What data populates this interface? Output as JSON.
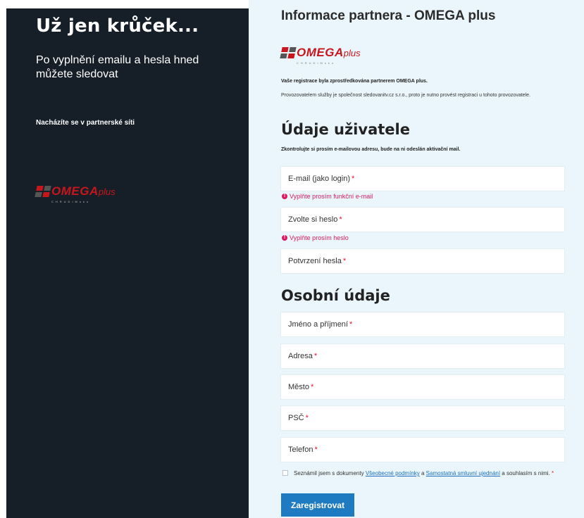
{
  "left": {
    "title": "Už jen krůček...",
    "subtitle": "Po vyplnění emailu a hesla hned můžete sledovat",
    "partner_note": "Nacházíte se v partnerské síti",
    "logo_text": "OMEGA",
    "logo_plus": "plus",
    "logo_small": "CHRUDIMsko"
  },
  "right": {
    "title": "Informace partnera - OMEGA plus",
    "logo_text": "OMEGA",
    "logo_plus": "plus",
    "logo_small": "CHRUDIMsko",
    "registration_note": "Vaše registrace byla zprostředkována partnerem OMEGA plus.",
    "provider_note": "Provozovatelem služby je společnost sledovanitv.cz s.r.o., proto je nutno provést registraci u tohoto provozovatele.",
    "user_section_title": "Údaje uživatele",
    "email_check_note": "Zkontrolujte si prosím e-mailovou adresu, bude na ni odeslán aktivační mail.",
    "personal_section_title": "Osobní údaje",
    "required_mark": "*",
    "fields": {
      "email": {
        "label": "E-mail (jako login)",
        "error": "Vyplňte prosím funkční e-mail"
      },
      "password": {
        "label": "Zvolte si heslo",
        "error": "Vyplňte prosím heslo"
      },
      "password_confirm": {
        "label": "Potvrzení hesla"
      },
      "name": {
        "label": "Jméno a příjmení"
      },
      "address": {
        "label": "Adresa"
      },
      "city": {
        "label": "Město"
      },
      "zip": {
        "label": "PSČ"
      },
      "phone": {
        "label": "Telefon"
      }
    },
    "consent": {
      "text_before": "Seznámil jsem s dokumenty ",
      "link1": "Všeobecné podmínky",
      "text_middle": " a ",
      "link2": "Samostatná smluvní ujednání",
      "text_after": " a souhlasím s nimi. "
    },
    "submit_label": "Zaregistrovat"
  },
  "colors": {
    "left_bg": "#161f27",
    "right_bg": "#eaf6fb",
    "brand_red": "#c8161d",
    "error": "#d81b60",
    "button": "#1f7bc1"
  }
}
